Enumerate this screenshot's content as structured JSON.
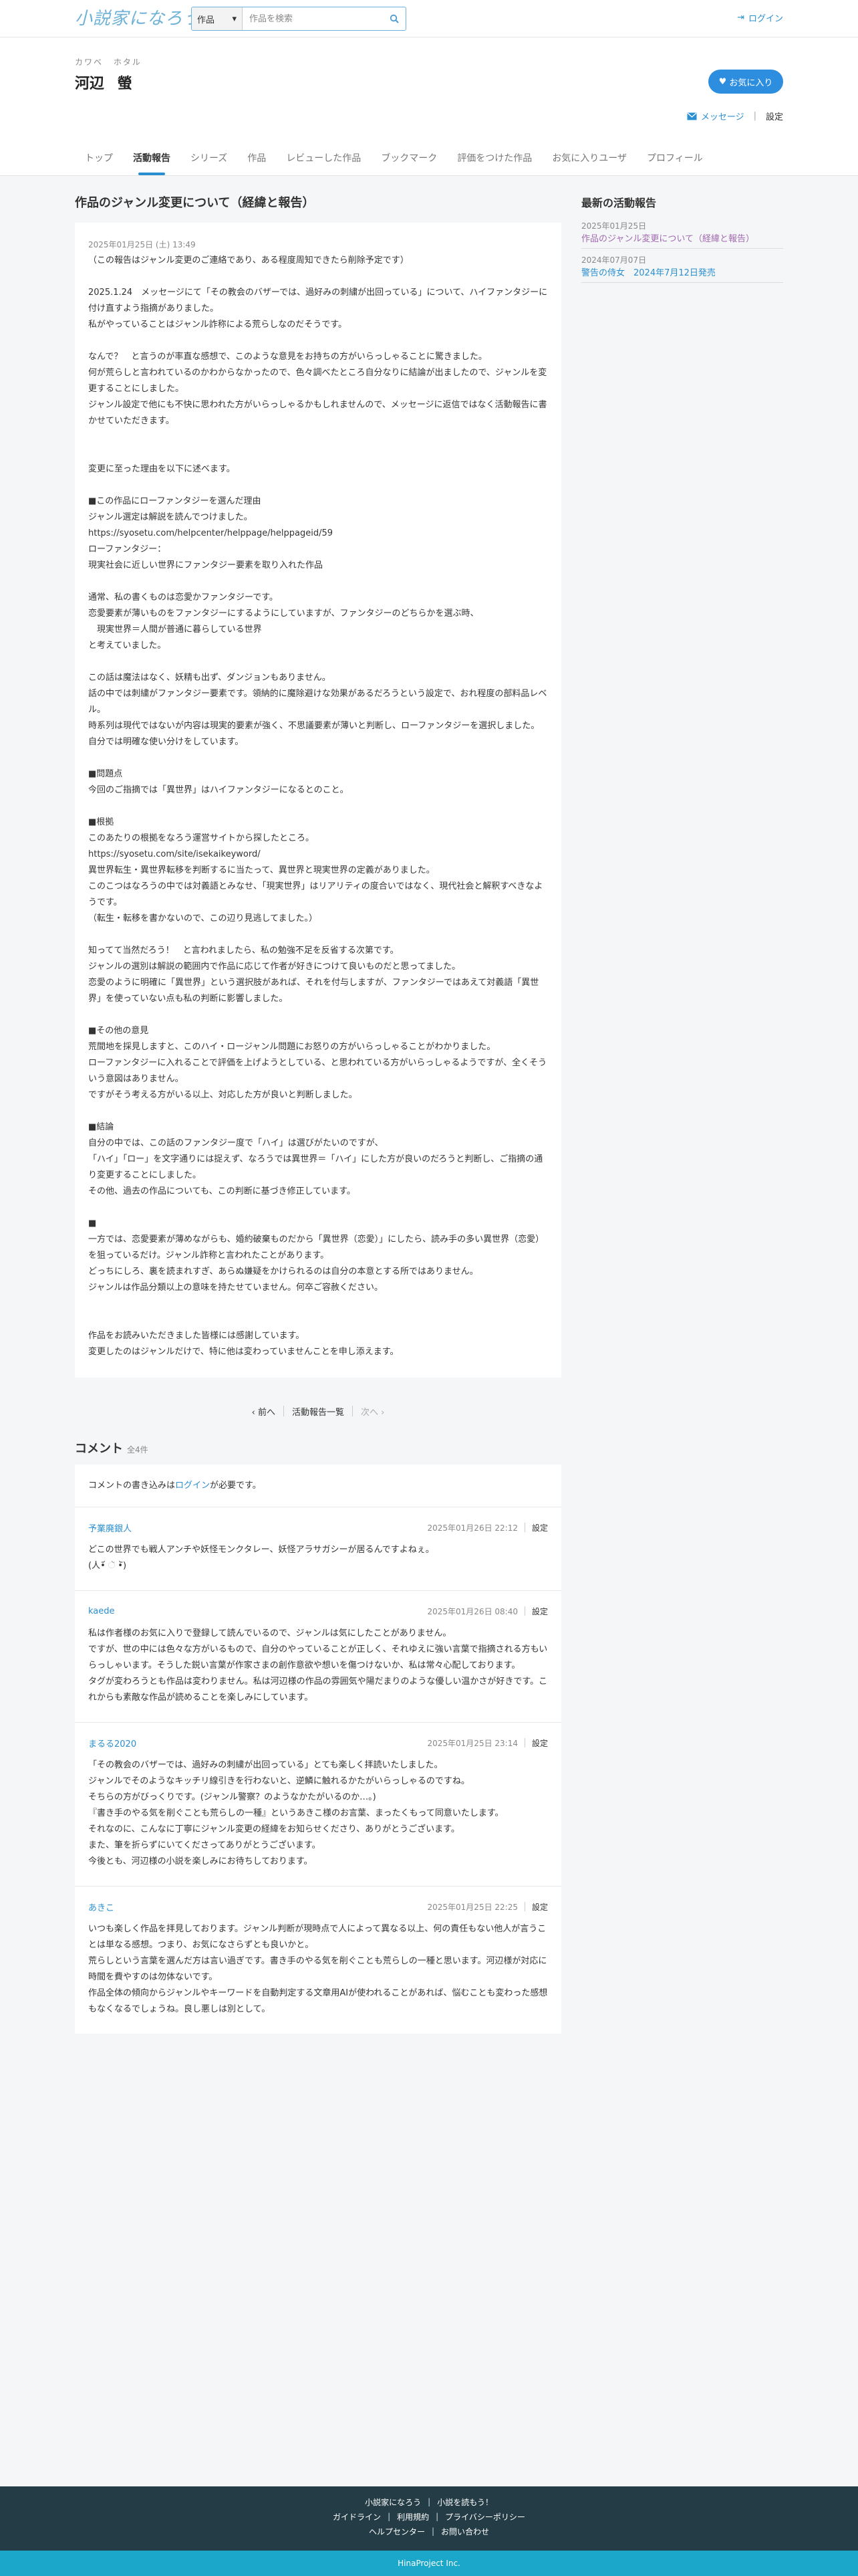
{
  "header": {
    "logo_small": "小説家",
    "logo_main": "小説家になろう",
    "search_select": "作品",
    "search_placeholder": "作品を検索",
    "login_label": "ログイン"
  },
  "user": {
    "kana": "カワベ ホタル",
    "name": "河辺 螢",
    "favorite_label": "お気に入り",
    "message_label": "メッセージ",
    "settings_label": "設定"
  },
  "tabs": [
    {
      "label": "トップ"
    },
    {
      "label": "活動報告"
    },
    {
      "label": "シリーズ"
    },
    {
      "label": "作品"
    },
    {
      "label": "レビューした作品"
    },
    {
      "label": "ブックマーク"
    },
    {
      "label": "評価をつけた作品"
    },
    {
      "label": "お気に入りユーザ"
    },
    {
      "label": "プロフィール"
    }
  ],
  "report": {
    "title": "作品のジャンル変更について（経緯と報告）",
    "date": "2025年01月25日 (土) 13:49",
    "body": "（この報告はジャンル変更のご連絡であり、ある程度周知できたら削除予定です）\n\n2025.1.24　メッセージにて「その教会のバザーでは、過好みの刺繍が出回っている」について、ハイファンタジーに付け直すよう指摘がありました。\n私がやっていることはジャンル詐称による荒らしなのだそうです。\n\nなんで？　と言うのが率直な感想で、このような意見をお持ちの方がいらっしゃることに驚きました。\n何が荒らしと言われているのかわからなかったので、色々調べたところ自分なりに結論が出ましたので、ジャンルを変更することにしました。\nジャンル設定で他にも不快に思われた方がいらっしゃるかもしれませんので、メッセージに返信ではなく活動報告に書かせていただきます。\n\n\n変更に至った理由を以下に述べます。\n\n■この作品にローファンタジーを選んだ理由\nジャンル選定は解説を読んでつけました。\nhttps://syosetu.com/helpcenter/helppage/helppageid/59\nローファンタジー：\n現実社会に近しい世界にファンタジー要素を取り入れた作品\n\n通常、私の書くものは恋愛かファンタジーです。\n恋愛要素が薄いものをファンタジーにするようにしていますが、ファンタジーのどちらかを選ぶ時、\n　現実世界＝人間が普通に暮らしている世界\nと考えていました。\n\nこの話は魔法はなく、妖精も出ず、ダンジョンもありません。\n話の中では刺繍がファンタジー要素です。領納的に魔除避けな効果があるだろうという設定で、おれ程度の部料品レベル。\n時系列は現代ではないが内容は現実的要素が強く、不思議要素が薄いと判断し、ローファンタジーを選択しました。自分では明確な使い分けをしています。\n\n■問題点\n今回のご指摘では「異世界」はハイファンタジーになるとのこと。\n\n■根拠\nこのあたりの根拠をなろう運営サイトから探したところ。\nhttps://syosetu.com/site/isekaikeyword/\n異世界転生・異世界転移を判断するに当たって、異世界と現実世界の定義がありました。\nこのこつはなろうの中では対義語とみなせ、「現実世界」はリアリティの度合いではなく、現代社会と解釈すべきなようです。\n（転生・転移を書かないので、この辺り見逃してました。）\n\n知ってて当然だろう！　と言われましたら、私の勉強不足を反省する次第です。\nジャンルの選別は解説の範囲内で作品に応じて作者が好きにつけて良いものだと思ってました。\n恋愛のように明確に「異世界」という選択肢があれば、それを付与しますが、ファンタジーではあえて対義語「異世界」を使っていない点も私の判断に影響しました。\n\n■その他の意見\n荒間地を採見しますと、このハイ・ロージャンル問題にお怒りの方がいらっしゃることがわかりました。\nローファンタジーに入れることで評価を上げようとしている、と思われている方がいらっしゃるようですが、全くそういう意図はありません。\nですがそう考える方がいる以上、対応した方が良いと判断しました。\n\n■結論\n自分の中では、この話のファンタジー度で「ハイ」は選びがたいのですが、\n「ハイ」「ロー」を文字通りには捉えず、なろうでは異世界＝「ハイ」にした方が良いのだろうと判断し、ご指摘の通り変更することにしました。\nその他、過去の作品についても、この判断に基づき修正しています。\n\n■\n一方では、恋愛要素が薄めながらも、婚約破棄ものだから「異世界（恋愛）」にしたら、読み手の多い異世界（恋愛）を狙っているだけ。ジャンル詐称と言われたことがあります。\nどっちにしろ、裏を読まれすぎ、あらぬ嫌疑をかけられるのは自分の本意とする所ではありません。\nジャンルは作品分類以上の意味を持たせていません。何卒ご容赦ください。\n\n\n作品をお読みいただきました皆様には感謝しています。\n変更したのはジャンルだけで、特に他は変わっていませんことを申し添えます。"
  },
  "pager": {
    "prev": "前へ",
    "list": "活動報告一覧",
    "next": "次へ"
  },
  "comments": {
    "title": "コメント",
    "count": "全4件",
    "login_prefix": "コメントの書き込みは",
    "login_link": "ログイン",
    "login_suffix": "が必要です。",
    "items": [
      {
        "name": "予業廃銀人",
        "date": "2025年01月26日 22:12",
        "settings": "設定",
        "body": "どこの世界でも戦人アンチや妖怪モンクタレー、妖怪アラサガシーが居るんですよねぇ。\n(人•᷄ ૅ •᷅)"
      },
      {
        "name": "kaede",
        "date": "2025年01月26日 08:40",
        "settings": "設定",
        "body": "私は作者様のお気に入りで登録して読んでいるので、ジャンルは気にしたことがありません。\nですが、世の中には色々な方がいるもので、自分のやっていることが正しく、それゆえに強い言葉で指摘される方もいらっしゃいます。そうした鋭い言葉が作家さまの創作意欲や想いを傷つけないか、私は常々心配しております。\nタグが変わろうとも作品は変わりません。私は河辺様の作品の雰囲気や陽だまりのような優しい温かさが好きです。これからも素敵な作品が読めることを楽しみにしています。"
      },
      {
        "name": "まるる2020",
        "date": "2025年01月25日 23:14",
        "settings": "設定",
        "body": "「その教会のバザーでは、過好みの刺繍が出回っている」とても楽しく拝読いたしました。\nジャンルでそのようなキッチリ線引きを行わないと、逆鱗に触れるかたがいらっしゃるのですね。\nそちらの方がびっくりです。(ジャンル警察？のようなかたがいるのか…。)\n『書き手のやる気を削ぐことも荒らしの一種』というあきこ様のお言葉、まったくもって同意いたします。\nそれなのに、こんなに丁寧にジャンル変更の経緯をお知らせくださり、ありがとうございます。\nまた、筆を折らずにいてくださってありがとうございます。\n今後とも、河辺様の小説を楽しみにお待ちしております。"
      },
      {
        "name": "あきこ",
        "date": "2025年01月25日 22:25",
        "settings": "設定",
        "body": "いつも楽しく作品を拝見しております。ジャンル判断が現時点で人によって異なる以上、何の責任もない他人が言うことは単なる感想。つまり、お気になさらずとも良いかと。\n荒らしという言葉を選んだ方は言い過ぎです。書き手のやる気を削ぐことも荒らしの一種と思います。河辺様が対応に時間を費やすのは勿体ないです。\n作品全体の傾向からジャンルやキーワードを自動判定する文章用AIが使われることがあれば、悩むことも変わった感想もなくなるでしょうね。良し悪しは別として。"
      }
    ]
  },
  "sidebar": {
    "title": "最新の活動報告",
    "items": [
      {
        "date": "2025年01月25日",
        "title": "作品のジャンル変更について（経緯と報告）"
      },
      {
        "date": "2024年07月07日",
        "title": "警告の侍女　2024年7月12日発売"
      }
    ]
  },
  "footer": {
    "row1": [
      "小説家になろう",
      "小説を読もう！"
    ],
    "row2": [
      "ガイドライン",
      "利用規約",
      "プライバシーポリシー"
    ],
    "row3": [
      "ヘルプセンター",
      "お問い合わせ"
    ],
    "copyright": "HinaProject Inc."
  },
  "colors": {
    "accent": "#2a8fd0",
    "footer": "#243c45",
    "copyright_bar": "#1aa7c9"
  }
}
